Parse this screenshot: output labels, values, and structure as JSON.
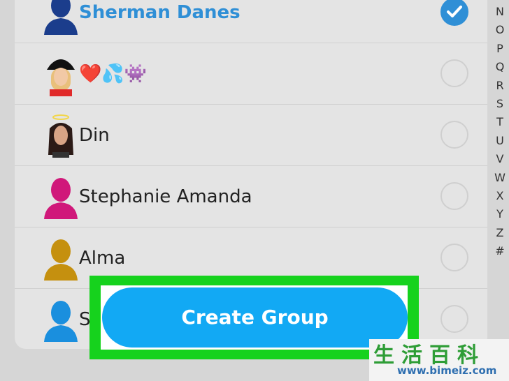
{
  "contacts": [
    {
      "name": "Sherman Danes",
      "selected": true,
      "avatar_color": "#1b3d8c",
      "avatar_type": "silhouette"
    },
    {
      "name": "❤️💦👾",
      "selected": false,
      "avatar_type": "bitmoji-hat"
    },
    {
      "name": "Din",
      "selected": false,
      "avatar_type": "bitmoji-halo"
    },
    {
      "name": "Stephanie Amanda",
      "selected": false,
      "avatar_color": "#d0187a",
      "avatar_type": "silhouette"
    },
    {
      "name": "Alma",
      "selected": false,
      "avatar_color": "#c5900f",
      "avatar_type": "silhouette"
    },
    {
      "name": "St",
      "selected": false,
      "avatar_color": "#1a8fde",
      "avatar_type": "silhouette"
    }
  ],
  "alphabet_index": [
    "N",
    "O",
    "P",
    "Q",
    "R",
    "S",
    "T",
    "U",
    "V",
    "W",
    "X",
    "Y",
    "Z",
    "#"
  ],
  "create_group_label": "Create Group",
  "highlight_color": "#16d21d",
  "accent_color": "#12a9f4",
  "watermark": {
    "chinese": "生活百科",
    "url": "www.bimeiz.com"
  }
}
